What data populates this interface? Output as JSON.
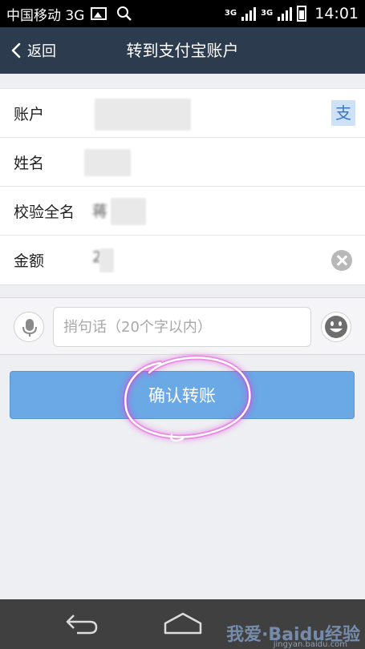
{
  "status_bar": {
    "carrier": "中国移动 3G",
    "net_label_1": "3G",
    "net_label_2": "3G",
    "time": "14:01"
  },
  "nav": {
    "back_label": "返回",
    "title": "转到支付宝账户"
  },
  "form": {
    "account_label": "账户",
    "name_label": "姓名",
    "verify_label": "校验全名",
    "verify_partial": "蒋",
    "amount_label": "金额",
    "amount_partial": "2",
    "contact_glyph": "支"
  },
  "message": {
    "placeholder": "捎句话（20个字以内）"
  },
  "confirm_label": "确认转账",
  "watermark": {
    "text": "我爱·Baidu经验",
    "sub": "jingyan.baidu.com"
  },
  "colors": {
    "nav_bg": "#2d3b4e",
    "button_bg": "#6aa8e6",
    "annotation": "#e23bd6"
  }
}
